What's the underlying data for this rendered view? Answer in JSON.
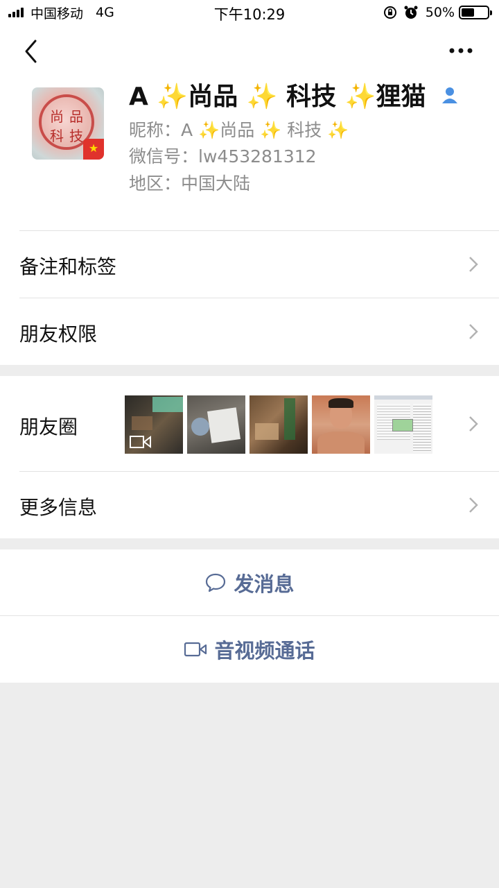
{
  "status_bar": {
    "carrier": "中国移动",
    "network": "4G",
    "time": "下午10:29",
    "battery": "50%",
    "battery_level": 0.5
  },
  "profile": {
    "name": "A ✨尚品 ✨ 科技 ✨狸猫",
    "name_parts": [
      "A ",
      "✨",
      "尚品 ",
      "✨",
      " 科技 ",
      "✨",
      "狸猫"
    ],
    "nickname_label": "昵称：",
    "nickname_value": "A ✨尚品 ✨ 科技 ✨",
    "wechat_id_label": "微信号：",
    "wechat_id_value": "lw453281312",
    "region_label": "地区：",
    "region_value": "中国大陆",
    "avatar_text": [
      "尚",
      "品",
      "科",
      "技"
    ]
  },
  "menu": {
    "remarks_tags": "备注和标签",
    "friend_permissions": "朋友权限",
    "moments": "朋友圈",
    "more_info": "更多信息"
  },
  "actions": {
    "send_message": "发消息",
    "video_call": "音视频通话"
  },
  "colors": {
    "accent": "#576b95",
    "background": "#ededed",
    "icon_blue": "#4a90e2"
  },
  "icons": {
    "back": "chevron-left-icon",
    "more": "more-dots-icon",
    "person": "person-icon",
    "chevron": "chevron-right-icon",
    "message": "chat-bubble-icon",
    "video": "video-camera-icon"
  }
}
